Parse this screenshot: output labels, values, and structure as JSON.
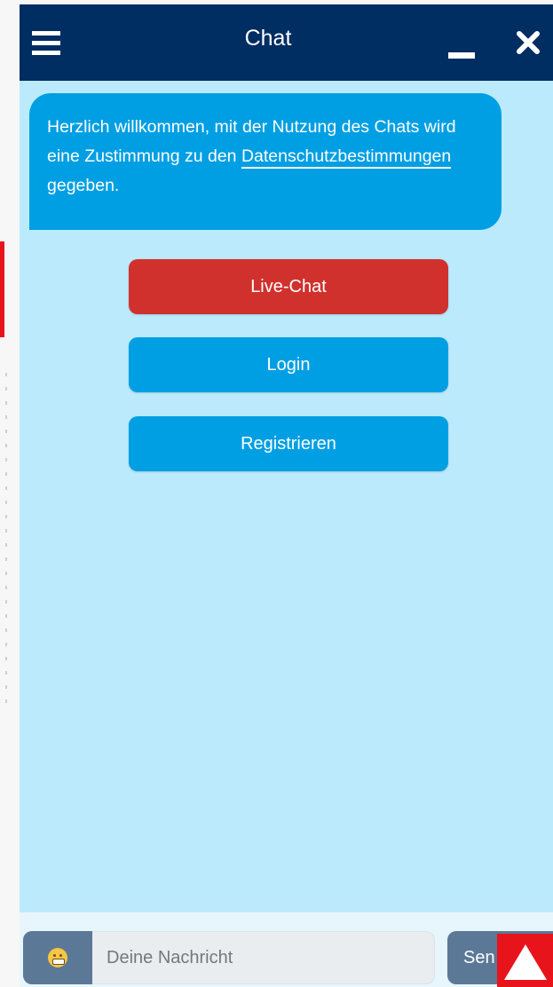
{
  "header": {
    "title": "Chat",
    "menu_icon": "hamburger-menu-icon",
    "minimize_icon": "minimize-icon",
    "close_icon": "close-icon",
    "background_color": "#002d62"
  },
  "welcome": {
    "text_before": "Herzlich willkommen, mit der Nutzung des Chats wird eine Zustimmung zu den ",
    "link_text": "Datenschutzbestimmungen",
    "text_after": " gegeben.",
    "bubble_color": "#009fe3"
  },
  "actions": {
    "live_chat": "Live-Chat",
    "login": "Login",
    "register": "Registrieren",
    "live_chat_color": "#d0312d",
    "default_color": "#009fe3"
  },
  "composer": {
    "emoji_icon": "grinning-face-icon",
    "placeholder": "Deine Nachricht",
    "send_label": "Sen"
  },
  "overlay": {
    "scroll_top_icon": "triangle-up-icon",
    "color": "#e8141c"
  },
  "colors": {
    "chat_background": "#bbeafc",
    "control_gray": "#5b7896"
  }
}
